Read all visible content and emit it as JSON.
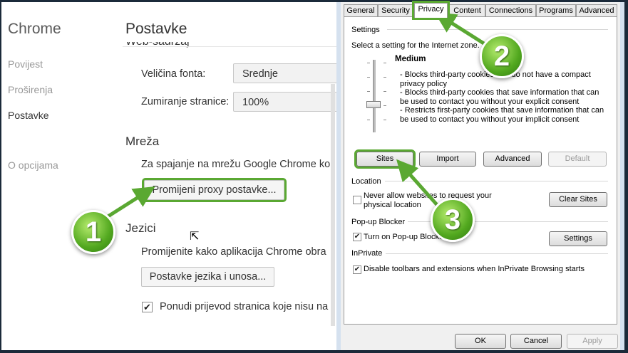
{
  "chrome": {
    "brand": "Chrome",
    "nav": [
      "Povijest",
      "Proširenja",
      "Postavke",
      "O opcijama"
    ],
    "page_title": "Postavke",
    "cut_heading": "Web-sadržaj",
    "font_size_label": "Veličina fonta:",
    "font_size_value": "Srednje",
    "zoom_label": "Zumiranje stranice:",
    "zoom_value": "100%",
    "network_heading": "Mreža",
    "network_text": "Za spajanje na mrežu Google Chrome ko",
    "proxy_button": "Promijeni proxy postavke...",
    "languages_heading": "Jezici",
    "languages_text": "Promijenite kako aplikacija Chrome obra",
    "languages_button": "Postavke jezika i unosa...",
    "translate_label": "Ponudi prijevod stranica koje nisu na",
    "translate_checked": "✔"
  },
  "dialog": {
    "tabs": [
      "General",
      "Security",
      "Privacy",
      "Content",
      "Connections",
      "Programs",
      "Advanced"
    ],
    "selected_tab": "Privacy",
    "settings_group": "Settings",
    "zone_text": "Select a setting for the Internet zone.",
    "level": "Medium",
    "desc_1": "- Blocks third-party cookies that do not have a compact privacy policy",
    "desc_2": "- Blocks third-party cookies that save information that can be used to contact you without your explicit consent",
    "desc_3": "- Restricts first-party cookies that save information that can be used to contact you without your implicit consent",
    "btn_sites": "Sites",
    "btn_import": "Import",
    "btn_advanced": "Advanced",
    "btn_default": "Default",
    "location_group": "Location",
    "location_check": "Never allow websites to request your physical location",
    "btn_clear_sites": "Clear Sites",
    "popup_group": "Pop-up Blocker",
    "popup_check": "Turn on Pop-up Blocker",
    "btn_popup_settings": "Settings",
    "inprivate_group": "InPrivate",
    "inprivate_check": "Disable toolbars and extensions when InPrivate Browsing starts",
    "btn_ok": "OK",
    "btn_cancel": "Cancel",
    "btn_apply": "Apply",
    "check_mark": "✔"
  },
  "annotations": {
    "step1": "1",
    "step2": "2",
    "step3": "3",
    "accent_color": "#5aa832"
  },
  "cursor_glyph": "⇱"
}
